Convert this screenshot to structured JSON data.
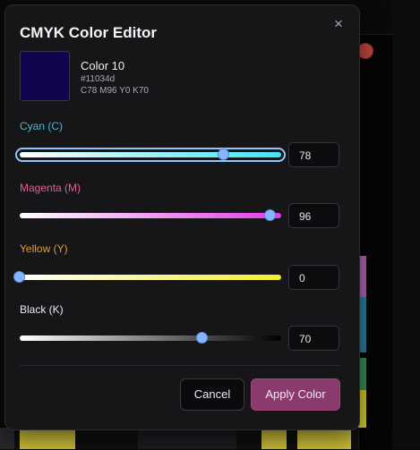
{
  "dialog": {
    "title": "CMYK Color Editor",
    "close_glyph": "×"
  },
  "color": {
    "name": "Color 10",
    "hex": "#11034d",
    "cmyk_text": "C78 M96 Y0 K70",
    "swatch_color": "#11034d"
  },
  "channels": [
    {
      "label": "Cyan (C)",
      "value": "78",
      "label_color": "#56b4d3",
      "track_start": "#ffffff",
      "track_end": "#3ee6f2"
    },
    {
      "label": "Magenta (M)",
      "value": "96",
      "label_color": "#e0608e",
      "track_start": "#ffffff",
      "track_end": "#e43be8"
    },
    {
      "label": "Yellow (Y)",
      "value": "0",
      "label_color": "#d9a03a",
      "track_start": "#ffffff",
      "track_end": "#f3ee2b"
    },
    {
      "label": "Black (K)",
      "value": "70",
      "label_color": "#ececf0",
      "track_start": "#ffffff",
      "track_end": "#000000"
    }
  ],
  "buttons": {
    "cancel_label": "Cancel",
    "apply_label": "Apply Color"
  },
  "colors": {
    "accent": "#8a3a6d",
    "thumb": "#87b4ff",
    "focus_ring": "#8ec7ff"
  }
}
